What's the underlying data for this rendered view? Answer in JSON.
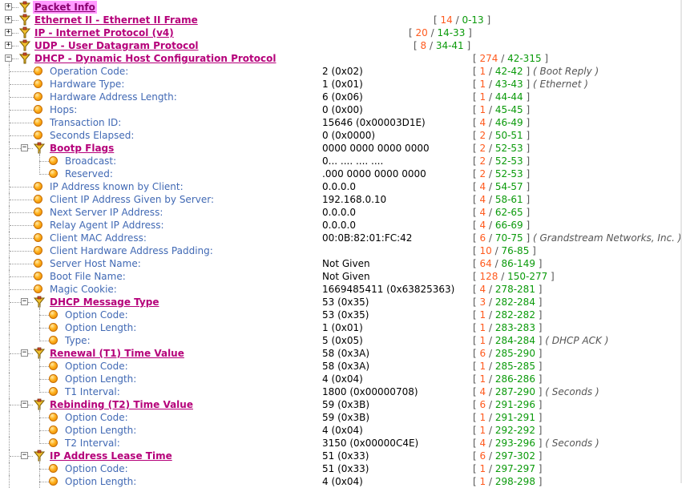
{
  "rows": [
    {
      "type": "hdr",
      "depth": 0,
      "expand": "+",
      "selected": true,
      "label": "Packet Info",
      "len": "",
      "off": "",
      "note": ""
    },
    {
      "type": "hdr",
      "depth": 0,
      "expand": "+",
      "label": "Ethernet II - Ethernet II Frame",
      "len": "14",
      "off": "0-13",
      "note": "",
      "rx": 541
    },
    {
      "type": "hdr",
      "depth": 0,
      "expand": "+",
      "label": "IP - Internet Protocol (v4)",
      "len": "20",
      "off": "14-33",
      "note": "",
      "rx": 510
    },
    {
      "type": "hdr",
      "depth": 0,
      "expand": "+",
      "label": "UDP - User Datagram Protocol",
      "len": "8",
      "off": "34-41",
      "note": "",
      "rx": 516
    },
    {
      "type": "hdr",
      "depth": 0,
      "expand": "-",
      "label": "DHCP - Dynamic Host Configuration Protocol",
      "len": "274",
      "off": "42-315",
      "note": "",
      "rx": 590
    },
    {
      "type": "field",
      "depth": 1,
      "label": "Operation Code:",
      "value": "2 (0x02)",
      "len": "1",
      "off": "42-42",
      "note": "Boot Reply"
    },
    {
      "type": "field",
      "depth": 1,
      "label": "Hardware Type:",
      "value": "1 (0x01)",
      "len": "1",
      "off": "43-43",
      "note": "Ethernet"
    },
    {
      "type": "field",
      "depth": 1,
      "label": "Hardware Address Length:",
      "value": "6 (0x06)",
      "len": "1",
      "off": "44-44",
      "note": ""
    },
    {
      "type": "field",
      "depth": 1,
      "label": "Hops:",
      "value": "0 (0x00)",
      "len": "1",
      "off": "45-45",
      "note": ""
    },
    {
      "type": "field",
      "depth": 1,
      "label": "Transaction ID:",
      "value": "15646 (0x00003D1E)",
      "len": "4",
      "off": "46-49",
      "note": ""
    },
    {
      "type": "field",
      "depth": 1,
      "label": "Seconds Elapsed:",
      "value": "0 (0x0000)",
      "len": "2",
      "off": "50-51",
      "note": ""
    },
    {
      "type": "sub",
      "depth": 1,
      "expand": "-",
      "label": "Bootp Flags",
      "value": "0000 0000 0000 0000",
      "len": "2",
      "off": "52-53",
      "note": ""
    },
    {
      "type": "field",
      "depth": 2,
      "label": "Broadcast:",
      "value": "0... .... .... ....",
      "len": "2",
      "off": "52-53",
      "note": ""
    },
    {
      "type": "field",
      "depth": 2,
      "last": true,
      "label": "Reserved:",
      "value": ".000 0000 0000 0000",
      "len": "2",
      "off": "52-53",
      "note": ""
    },
    {
      "type": "field",
      "depth": 1,
      "label": "IP Address known by Client:",
      "value": "0.0.0.0",
      "len": "4",
      "off": "54-57",
      "note": ""
    },
    {
      "type": "field",
      "depth": 1,
      "label": "Client IP Address Given by Server:",
      "value": "192.168.0.10",
      "len": "4",
      "off": "58-61",
      "note": ""
    },
    {
      "type": "field",
      "depth": 1,
      "label": "Next Server IP Address:",
      "value": "0.0.0.0",
      "len": "4",
      "off": "62-65",
      "note": ""
    },
    {
      "type": "field",
      "depth": 1,
      "label": "Relay Agent IP Address:",
      "value": "0.0.0.0",
      "len": "4",
      "off": "66-69",
      "note": ""
    },
    {
      "type": "field",
      "depth": 1,
      "label": "Client MAC Address:",
      "value": "00:0B:82:01:FC:42",
      "len": "6",
      "off": "70-75",
      "note": "Grandstream Networks, Inc."
    },
    {
      "type": "field",
      "depth": 1,
      "label": "Client Hardware Address Padding:",
      "value": "",
      "len": "10",
      "off": "76-85",
      "note": ""
    },
    {
      "type": "field",
      "depth": 1,
      "label": "Server Host Name:",
      "value": "Not Given",
      "len": "64",
      "off": "86-149",
      "note": ""
    },
    {
      "type": "field",
      "depth": 1,
      "label": "Boot File Name:",
      "value": "Not Given",
      "len": "128",
      "off": "150-277",
      "note": ""
    },
    {
      "type": "field",
      "depth": 1,
      "label": "Magic Cookie:",
      "value": "1669485411 (0x63825363)",
      "len": "4",
      "off": "278-281",
      "note": ""
    },
    {
      "type": "sub",
      "depth": 1,
      "expand": "-",
      "label": "DHCP Message Type",
      "value": "53 (0x35)",
      "len": "3",
      "off": "282-284",
      "note": ""
    },
    {
      "type": "field",
      "depth": 2,
      "label": "Option Code:",
      "value": "53 (0x35)",
      "len": "1",
      "off": "282-282",
      "note": ""
    },
    {
      "type": "field",
      "depth": 2,
      "label": "Option Length:",
      "value": "1 (0x01)",
      "len": "1",
      "off": "283-283",
      "note": ""
    },
    {
      "type": "field",
      "depth": 2,
      "last": true,
      "label": "Type:",
      "value": "5 (0x05)",
      "len": "1",
      "off": "284-284",
      "note": "DHCP ACK"
    },
    {
      "type": "sub",
      "depth": 1,
      "expand": "-",
      "label": "Renewal (T1) Time Value",
      "value": "58 (0x3A)",
      "len": "6",
      "off": "285-290",
      "note": ""
    },
    {
      "type": "field",
      "depth": 2,
      "label": "Option Code:",
      "value": "58 (0x3A)",
      "len": "1",
      "off": "285-285",
      "note": ""
    },
    {
      "type": "field",
      "depth": 2,
      "label": "Option Length:",
      "value": "4 (0x04)",
      "len": "1",
      "off": "286-286",
      "note": ""
    },
    {
      "type": "field",
      "depth": 2,
      "last": true,
      "label": "T1 Interval:",
      "value": "1800 (0x00000708)",
      "len": "4",
      "off": "287-290",
      "note": "Seconds"
    },
    {
      "type": "sub",
      "depth": 1,
      "expand": "-",
      "label": "Rebinding (T2) Time Value",
      "value": "59 (0x3B)",
      "len": "6",
      "off": "291-296",
      "note": ""
    },
    {
      "type": "field",
      "depth": 2,
      "label": "Option Code:",
      "value": "59 (0x3B)",
      "len": "1",
      "off": "291-291",
      "note": ""
    },
    {
      "type": "field",
      "depth": 2,
      "label": "Option Length:",
      "value": "4 (0x04)",
      "len": "1",
      "off": "292-292",
      "note": ""
    },
    {
      "type": "field",
      "depth": 2,
      "last": true,
      "label": "T2 Interval:",
      "value": "3150 (0x00000C4E)",
      "len": "4",
      "off": "293-296",
      "note": "Seconds"
    },
    {
      "type": "sub",
      "depth": 1,
      "expand": "-",
      "label": "IP Address Lease Time",
      "value": "51 (0x33)",
      "len": "6",
      "off": "297-302",
      "note": ""
    },
    {
      "type": "field",
      "depth": 2,
      "label": "Option Code:",
      "value": "51 (0x33)",
      "len": "1",
      "off": "297-297",
      "note": ""
    },
    {
      "type": "field",
      "depth": 2,
      "label": "Option Length:",
      "value": "4 (0x04)",
      "len": "1",
      "off": "298-298",
      "note": ""
    }
  ],
  "icons": {
    "expand": "expand-box-icon",
    "header": "protocol-node-icon",
    "field": "field-bullet-icon"
  },
  "colors": {
    "header": "#b5007a",
    "selected_bg": "#ff99ff",
    "label": "#4169b4",
    "length": "#ff5a1e",
    "offset": "#0a9a0a"
  }
}
